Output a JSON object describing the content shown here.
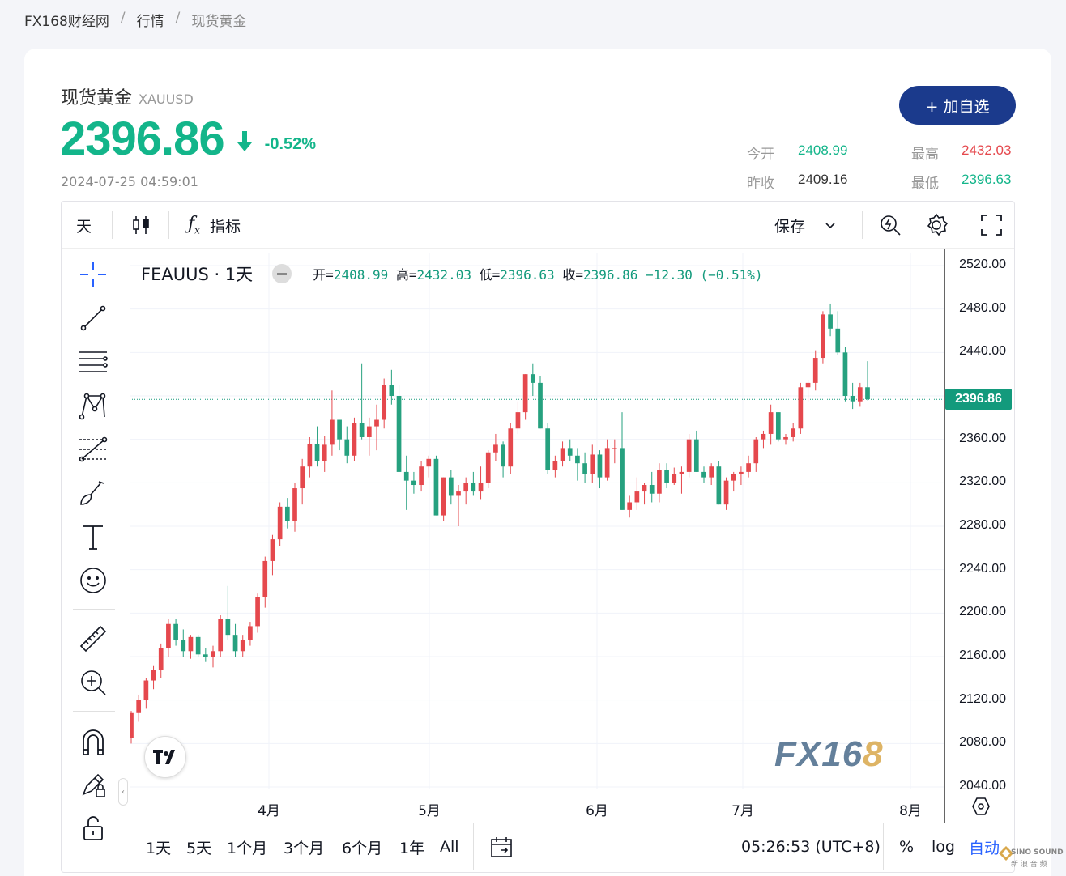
{
  "breadcrumb": {
    "site": "FX168财经网",
    "section": "行情",
    "current": "现货黄金",
    "sep": "/"
  },
  "header": {
    "name": "现货黄金",
    "code": "XAUUSD",
    "price": "2396.86",
    "change_pct": "-0.52%",
    "timestamp": "2024-07-25 04:59:01",
    "add_button": "+ 加自选"
  },
  "stats": {
    "open_label": "今开",
    "open": "2408.99",
    "high_label": "最高",
    "high": "2432.03",
    "prevclose_label": "昨收",
    "prevclose": "2409.16",
    "low_label": "最低",
    "low": "2396.63"
  },
  "colors": {
    "up": "#13b58a",
    "down": "#e5484d",
    "button": "#1b3a8c",
    "candle_up": "#e5484d",
    "candle_down": "#26a17f"
  },
  "toolbar": {
    "interval": "天",
    "indicators": "指标",
    "save": "保存"
  },
  "legend": {
    "symbol": "FEAUUS · 1天",
    "o_label": "开=",
    "o": "2408.99",
    "h_label": "高=",
    "h": "2432.03",
    "l_label": "低=",
    "l": "2396.63",
    "c_label": "收=",
    "c": "2396.86",
    "chg": "−12.30 (−0.51%)"
  },
  "bottombar": {
    "ranges": [
      "1天",
      "5天",
      "1个月",
      "3个月",
      "6个月",
      "1年",
      "All"
    ],
    "clock": "05:26:53 (UTC+8)",
    "pct": "%",
    "log": "log",
    "auto": "自动"
  },
  "watermark": {
    "text": "FX16",
    "accent": "8"
  },
  "sino": {
    "line1": "SINO SOUND",
    "line2": "新 浪 音 频"
  },
  "chart_data": {
    "type": "candlestick",
    "price_axis": [
      "2520.00",
      "2480.00",
      "2440.00",
      "2400.00",
      "2360.00",
      "2320.00",
      "2280.00",
      "2240.00",
      "2200.00",
      "2160.00",
      "2120.00",
      "2080.00",
      "2040.00"
    ],
    "current_price": "2396.86",
    "x_labels": [
      "4月",
      "5月",
      "6月",
      "7月",
      "8月"
    ],
    "ylim": [
      2040,
      2520
    ],
    "candles": [
      [
        2085,
        2110,
        2080,
        2108
      ],
      [
        2108,
        2125,
        2100,
        2120
      ],
      [
        2120,
        2140,
        2112,
        2138
      ],
      [
        2138,
        2152,
        2130,
        2148
      ],
      [
        2148,
        2172,
        2140,
        2168
      ],
      [
        2168,
        2195,
        2160,
        2190
      ],
      [
        2190,
        2195,
        2170,
        2175
      ],
      [
        2175,
        2185,
        2160,
        2165
      ],
      [
        2165,
        2180,
        2158,
        2178
      ],
      [
        2178,
        2180,
        2160,
        2162
      ],
      [
        2162,
        2168,
        2155,
        2160
      ],
      [
        2160,
        2170,
        2150,
        2165
      ],
      [
        2165,
        2198,
        2160,
        2195
      ],
      [
        2195,
        2225,
        2175,
        2180
      ],
      [
        2180,
        2190,
        2160,
        2165
      ],
      [
        2165,
        2180,
        2160,
        2175
      ],
      [
        2175,
        2192,
        2170,
        2188
      ],
      [
        2188,
        2218,
        2182,
        2215
      ],
      [
        2215,
        2252,
        2205,
        2248
      ],
      [
        2248,
        2272,
        2235,
        2268
      ],
      [
        2268,
        2302,
        2262,
        2298
      ],
      [
        2298,
        2306,
        2278,
        2285
      ],
      [
        2285,
        2320,
        2275,
        2315
      ],
      [
        2315,
        2342,
        2300,
        2335
      ],
      [
        2335,
        2362,
        2325,
        2356
      ],
      [
        2356,
        2372,
        2335,
        2340
      ],
      [
        2340,
        2363,
        2330,
        2355
      ],
      [
        2355,
        2405,
        2345,
        2378
      ],
      [
        2378,
        2368,
        2350,
        2360
      ],
      [
        2360,
        2372,
        2338,
        2345
      ],
      [
        2345,
        2380,
        2340,
        2375
      ],
      [
        2375,
        2430,
        2360,
        2362
      ],
      [
        2362,
        2380,
        2345,
        2372
      ],
      [
        2372,
        2392,
        2350,
        2378
      ],
      [
        2378,
        2416,
        2370,
        2410
      ],
      [
        2410,
        2424,
        2392,
        2400
      ],
      [
        2400,
        2410,
        2330,
        2330
      ],
      [
        2330,
        2345,
        2295,
        2322
      ],
      [
        2322,
        2330,
        2310,
        2318
      ],
      [
        2318,
        2340,
        2312,
        2335
      ],
      [
        2335,
        2345,
        2325,
        2342
      ],
      [
        2342,
        2345,
        2290,
        2290
      ],
      [
        2290,
        2325,
        2285,
        2325
      ],
      [
        2325,
        2332,
        2300,
        2308
      ],
      [
        2308,
        2318,
        2280,
        2312
      ],
      [
        2312,
        2325,
        2300,
        2320
      ],
      [
        2320,
        2330,
        2308,
        2312
      ],
      [
        2312,
        2335,
        2305,
        2320
      ],
      [
        2320,
        2350,
        2315,
        2348
      ],
      [
        2348,
        2365,
        2340,
        2355
      ],
      [
        2355,
        2358,
        2325,
        2335
      ],
      [
        2335,
        2375,
        2328,
        2370
      ],
      [
        2370,
        2395,
        2365,
        2385
      ],
      [
        2385,
        2408,
        2378,
        2420
      ],
      [
        2420,
        2430,
        2400,
        2412
      ],
      [
        2412,
        2418,
        2370,
        2370
      ],
      [
        2370,
        2375,
        2328,
        2332
      ],
      [
        2332,
        2345,
        2325,
        2340
      ],
      [
        2340,
        2358,
        2335,
        2352
      ],
      [
        2352,
        2360,
        2340,
        2345
      ],
      [
        2345,
        2352,
        2322,
        2338
      ],
      [
        2338,
        2348,
        2320,
        2328
      ],
      [
        2328,
        2355,
        2320,
        2346
      ],
      [
        2346,
        2350,
        2315,
        2325
      ],
      [
        2325,
        2360,
        2322,
        2352
      ],
      [
        2352,
        2360,
        2338,
        2352
      ],
      [
        2352,
        2385,
        2330,
        2295
      ],
      [
        2295,
        2308,
        2288,
        2302
      ],
      [
        2302,
        2325,
        2295,
        2312
      ],
      [
        2312,
        2320,
        2300,
        2318
      ],
      [
        2318,
        2330,
        2302,
        2310
      ],
      [
        2310,
        2338,
        2302,
        2332
      ],
      [
        2332,
        2338,
        2315,
        2320
      ],
      [
        2320,
        2334,
        2318,
        2328
      ],
      [
        2328,
        2335,
        2310,
        2330
      ],
      [
        2330,
        2365,
        2325,
        2360
      ],
      [
        2360,
        2368,
        2330,
        2330
      ],
      [
        2330,
        2335,
        2320,
        2325
      ],
      [
        2325,
        2338,
        2318,
        2335
      ],
      [
        2335,
        2340,
        2300,
        2300
      ],
      [
        2300,
        2325,
        2295,
        2322
      ],
      [
        2322,
        2330,
        2312,
        2328
      ],
      [
        2328,
        2335,
        2318,
        2330
      ],
      [
        2330,
        2345,
        2325,
        2338
      ],
      [
        2338,
        2362,
        2330,
        2360
      ],
      [
        2360,
        2368,
        2352,
        2365
      ],
      [
        2365,
        2392,
        2355,
        2385
      ],
      [
        2385,
        2378,
        2358,
        2360
      ],
      [
        2360,
        2365,
        2355,
        2362
      ],
      [
        2362,
        2375,
        2358,
        2370
      ],
      [
        2370,
        2412,
        2365,
        2408
      ],
      [
        2408,
        2415,
        2395,
        2412
      ],
      [
        2412,
        2442,
        2405,
        2435
      ],
      [
        2435,
        2478,
        2430,
        2475
      ],
      [
        2475,
        2485,
        2455,
        2462
      ],
      [
        2462,
        2478,
        2438,
        2440
      ],
      [
        2440,
        2445,
        2395,
        2400
      ],
      [
        2400,
        2412,
        2388,
        2395
      ],
      [
        2395,
        2412,
        2390,
        2408
      ],
      [
        2408,
        2432,
        2396,
        2397
      ]
    ]
  }
}
